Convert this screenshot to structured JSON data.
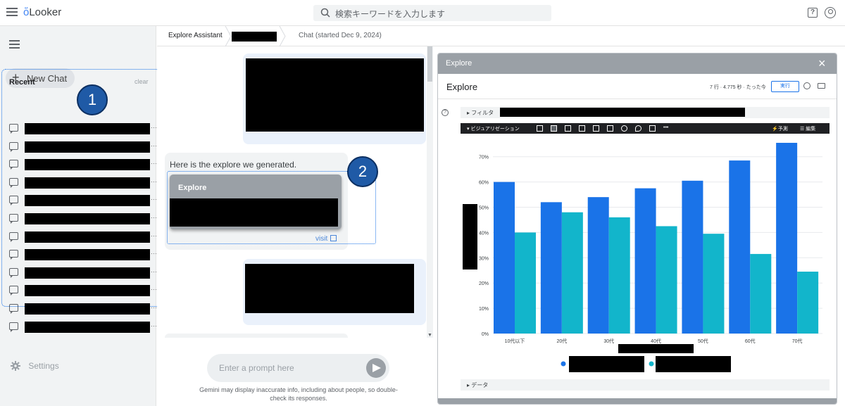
{
  "topbar": {
    "logo_text": "Looker",
    "search_placeholder": "検索キーワードを入力します",
    "help_label": "?",
    "icons": [
      "hamburger-icon",
      "search-icon",
      "help-icon",
      "account-icon"
    ]
  },
  "sidebar": {
    "new_chat_label": "New Chat",
    "recent_label": "Recent",
    "clear_label": "clear",
    "settings_label": "Settings",
    "item_count": 12
  },
  "annotations": {
    "badge_1": "1",
    "badge_2": "2"
  },
  "breadcrumb": {
    "root": "Explore Assistant",
    "chat": "Chat (started Dec 9, 2024)"
  },
  "chat": {
    "assistant_message": "Here is the explore we generated.",
    "card_title": "Explore",
    "visit_label": "visit",
    "prompt_placeholder": "Enter a prompt here",
    "disclaimer": "Gemini may display inaccurate info, including about people, so double-check its responses."
  },
  "explore_panel": {
    "header": "Explore",
    "title": "Explore",
    "meta": "7 行 · 4.775 秒 · たった今",
    "run_label": "実行",
    "filter_label": "フィルタ",
    "viz_label": "ビジュアリゼーション",
    "forecast_label": "予測",
    "edit_label": "編集",
    "data_label": "データ",
    "close_label": "×"
  },
  "colors": {
    "series_1": "#1a73e8",
    "series_2": "#12b5cb"
  },
  "chart_data": {
    "type": "bar",
    "categories": [
      "10代以下",
      "20代",
      "30代",
      "40代",
      "50代",
      "60代",
      "70代"
    ],
    "series": [
      {
        "values": [
          60,
          52,
          54,
          57.5,
          60.5,
          68.5,
          75.5
        ]
      },
      {
        "values": [
          40,
          48,
          46,
          42.5,
          39.5,
          31.5,
          24.5
        ]
      }
    ],
    "yticks": [
      "0%",
      "10%",
      "20%",
      "30%",
      "40%",
      "50%",
      "60%",
      "70%"
    ],
    "ylim": [
      0,
      78
    ],
    "grid": true,
    "legend_position": "bottom"
  }
}
